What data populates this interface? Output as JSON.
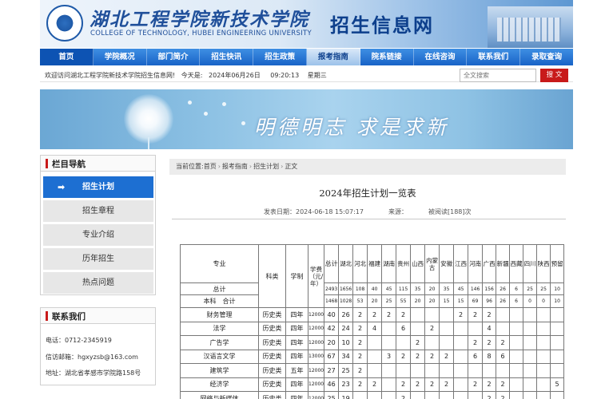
{
  "header": {
    "school_cn": "湖北工程学院新技术学院",
    "school_en": "COLLEGE OF TECHNOLOGY, HUBEI ENGINEERING UNIVERSITY",
    "site_name": "招生信息网"
  },
  "nav": [
    "首页",
    "学院概况",
    "部门简介",
    "招生快讯",
    "招生政策",
    "报考指南",
    "院系链接",
    "在线咨询",
    "联系我们",
    "录取查询"
  ],
  "infobar": {
    "welcome": "欢迎访问湖北工程学院新技术学院招生信息网!",
    "today_label": "今天是:",
    "date": "2024年06月26日",
    "time": "09:20:13",
    "weekday": "星期三",
    "search_placeholder": "全文搜索",
    "search_button": "搜 文"
  },
  "banner": {
    "motto": "明德明志 求是求新"
  },
  "sidebar": {
    "title": "栏目导航",
    "items": [
      "招生计划",
      "招生章程",
      "专业介绍",
      "历年招生",
      "热点问题"
    ],
    "contact_title": "联系我们",
    "phone": "电话：0712-2345919",
    "email": "信访邮箱：hgxyzsb@163.com",
    "address": "地址：湖北省孝感市学院路158号"
  },
  "breadcrumb": [
    "当前位置:首页",
    "报考指南",
    "招生计划",
    "正文"
  ],
  "article": {
    "title": "2024年招生计划一览表",
    "date": "发表日期：2024-06-18 15:07:17",
    "source": "来源：",
    "views": "被阅读[188]次"
  },
  "table": {
    "h_major": "专业",
    "h_category": "科类",
    "h_duration": "学制",
    "h_fee": "学费（元/年）",
    "h_total": "总计",
    "provinces": [
      "湖北",
      "河北",
      "福建",
      "湖南",
      "贵州",
      "山西",
      "内蒙古",
      "安徽",
      "江西",
      "河南",
      "广西",
      "新疆",
      "西藏",
      "四川",
      "陕西",
      "预留"
    ],
    "total_label": "总计",
    "total_values": [
      "2493",
      "1656",
      "108",
      "40",
      "45",
      "115",
      "35",
      "20",
      "35",
      "45",
      "146",
      "156",
      "26",
      "6",
      "25",
      "25",
      "10"
    ],
    "undergrad_label": "本科　合计",
    "undergrad_values": [
      "1468",
      "1028",
      "53",
      "20",
      "25",
      "55",
      "20",
      "20",
      "15",
      "15",
      "69",
      "96",
      "26",
      "6",
      "0",
      "0",
      "10"
    ],
    "rows": [
      {
        "major": "财务管理",
        "cat": "历史类",
        "dur": "四年",
        "fee": "12000",
        "cells": [
          "40",
          "26",
          "2",
          "2",
          "2",
          "2",
          "",
          "",
          "",
          "2",
          "2",
          "2",
          "",
          "",
          "",
          "",
          ""
        ]
      },
      {
        "major": "法学",
        "cat": "历史类",
        "dur": "四年",
        "fee": "12000",
        "cells": [
          "42",
          "24",
          "2",
          "4",
          "",
          "6",
          "",
          "2",
          "",
          "",
          "",
          "4",
          "",
          "",
          "",
          "",
          ""
        ]
      },
      {
        "major": "广告学",
        "cat": "历史类",
        "dur": "四年",
        "fee": "12000",
        "cells": [
          "20",
          "10",
          "2",
          "",
          "",
          "",
          "2",
          "",
          "",
          "",
          "2",
          "2",
          "2",
          "",
          "",
          "",
          ""
        ]
      },
      {
        "major": "汉语言文学",
        "cat": "历史类",
        "dur": "四年",
        "fee": "13000",
        "cells": [
          "67",
          "34",
          "2",
          "",
          "3",
          "2",
          "2",
          "2",
          "2",
          "",
          "6",
          "8",
          "6",
          "",
          "",
          "",
          ""
        ]
      },
      {
        "major": "建筑学",
        "cat": "历史类",
        "dur": "五年",
        "fee": "12000",
        "cells": [
          "27",
          "25",
          "2",
          "",
          "",
          "",
          "",
          "",
          "",
          "",
          "",
          "",
          "",
          "",
          "",
          "",
          ""
        ]
      },
      {
        "major": "经济学",
        "cat": "历史类",
        "dur": "四年",
        "fee": "12000",
        "cells": [
          "46",
          "23",
          "2",
          "2",
          "",
          "2",
          "2",
          "2",
          "2",
          "",
          "2",
          "2",
          "2",
          "",
          "",
          "",
          "5"
        ]
      },
      {
        "major": "网络与新媒体",
        "cat": "历史类",
        "dur": "四年",
        "fee": "12000",
        "cells": [
          "25",
          "19",
          "",
          "",
          "",
          "2",
          "",
          "",
          "",
          "",
          "",
          "2",
          "2",
          "",
          "",
          "",
          ""
        ]
      }
    ]
  }
}
